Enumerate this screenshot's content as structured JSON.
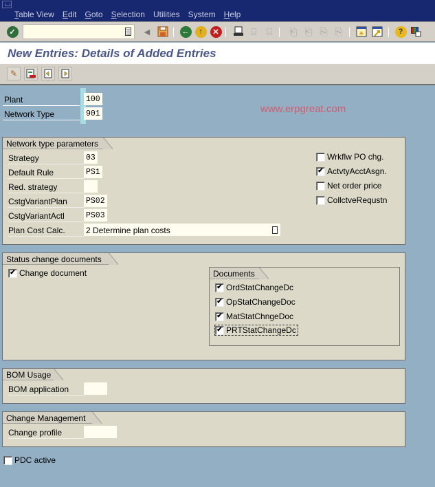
{
  "menubar": {
    "items": [
      {
        "label": "Table View",
        "mnemonic": "T",
        "rest": "able View"
      },
      {
        "label": "Edit",
        "mnemonic": "E",
        "rest": "dit"
      },
      {
        "label": "Goto",
        "mnemonic": "G",
        "rest": "oto"
      },
      {
        "label": "Selection",
        "mnemonic": "S",
        "rest": "election"
      },
      {
        "label": "Utilities",
        "mnemonic": "",
        "rest": "Utilities"
      },
      {
        "label": "System",
        "mnemonic": "",
        "rest": "System"
      },
      {
        "label": "Help",
        "mnemonic": "H",
        "rest": "elp"
      }
    ]
  },
  "toolbar": {
    "command_field_value": "",
    "icons": [
      "enter-icon",
      "command-dropdown-icon",
      "back-arrow-icon",
      "save-icon",
      "back-icon",
      "exit-icon",
      "cancel-icon",
      "print-icon",
      "find-icon",
      "find-next-icon",
      "first-page-icon",
      "previous-page-icon",
      "next-page-icon",
      "last-page-icon",
      "create-session-icon",
      "generate-shortcut-icon",
      "help-icon",
      "layout-menu-icon"
    ]
  },
  "title": "New Entries: Details of Added Entries",
  "app_toolbar": {
    "icons": [
      "change-display-icon",
      "delete-icon",
      "previous-entry-icon",
      "next-entry-icon"
    ]
  },
  "header": {
    "plant_label": "Plant",
    "plant_value": "100",
    "network_type_label": "Network Type",
    "network_type_value": "901"
  },
  "watermark": "www.erpgreat.com",
  "network_params": {
    "title": "Network type parameters",
    "fields": [
      {
        "label": "Strategy",
        "value": "03"
      },
      {
        "label": "Default Rule",
        "value": "PS1"
      },
      {
        "label": "Red. strategy",
        "value": ""
      },
      {
        "label": "CstgVariantPlan",
        "value": "PS02"
      },
      {
        "label": "CstgVariantActl",
        "value": "PS03"
      },
      {
        "label": "Plan Cost Calc.",
        "value": "2 Determine plan costs"
      }
    ],
    "checkboxes": [
      {
        "label": "Wrkflw PO chg.",
        "checked": false
      },
      {
        "label": "ActvtyAcctAsgn.",
        "checked": true
      },
      {
        "label": "Net order price",
        "checked": false
      },
      {
        "label": "CollctveRequstn",
        "checked": false
      }
    ]
  },
  "status_change": {
    "title": "Status change documents",
    "change_document_label": "Change document",
    "change_document_checked": true,
    "documents_title": "Documents",
    "documents": [
      {
        "label": "OrdStatChangeDc",
        "checked": true
      },
      {
        "label": "OpStatChangeDoc",
        "checked": true
      },
      {
        "label": "MatStatChngeDoc",
        "checked": true
      },
      {
        "label": "PRTStatChangeDc",
        "checked": true
      }
    ]
  },
  "bom_usage": {
    "title": "BOM Usage",
    "label": "BOM application",
    "value": ""
  },
  "change_mgmt": {
    "title": "Change Management",
    "label": "Change profile",
    "value": ""
  },
  "pdc_active": {
    "label": "PDC active",
    "checked": false
  },
  "check_glyph": "✔"
}
